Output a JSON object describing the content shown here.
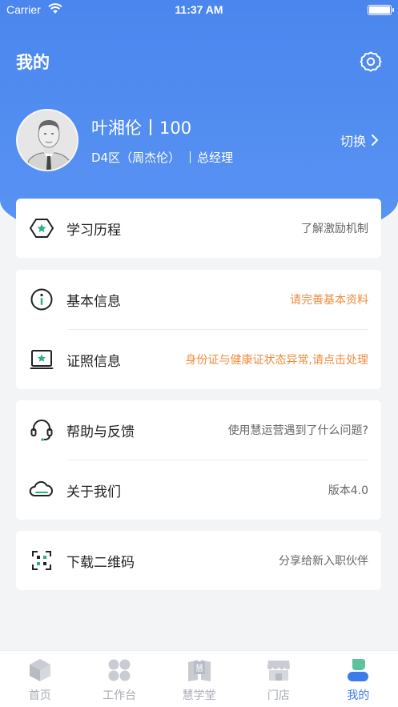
{
  "status_bar": {
    "carrier": "Carrier",
    "time": "11:37 AM"
  },
  "header": {
    "title": "我的"
  },
  "user": {
    "name": "叶湘伦",
    "score": "100",
    "dept": "D4区（周杰伦）",
    "role": "总经理",
    "switch_label": "切换"
  },
  "sections": {
    "learning": {
      "label": "学习历程",
      "desc": "了解激励机制"
    },
    "basic_info": {
      "label": "基本信息",
      "desc": "请完善基本资料"
    },
    "license_info": {
      "label": "证照信息",
      "desc": "身份证与健康证状态异常,请点击处理"
    },
    "help": {
      "label": "帮助与反馈",
      "desc": "使用慧运营遇到了什么问题?"
    },
    "about": {
      "label": "关于我们",
      "desc": "版本4.0"
    },
    "qrcode": {
      "label": "下载二维码",
      "desc": "分享给新入职伙伴"
    }
  },
  "tabbar": {
    "items": [
      {
        "label": "首页",
        "icon": "home-cube-icon"
      },
      {
        "label": "工作台",
        "icon": "workbench-grid-icon"
      },
      {
        "label": "慧学堂",
        "icon": "book-icon"
      },
      {
        "label": "门店",
        "icon": "store-icon"
      },
      {
        "label": "我的",
        "icon": "profile-icon"
      }
    ],
    "active_index": 4
  },
  "colors": {
    "header_blue": "#4a86ee",
    "warning_orange": "#f08a3c",
    "icon_green": "#2bb07f",
    "tab_active": "#3d7bea"
  }
}
